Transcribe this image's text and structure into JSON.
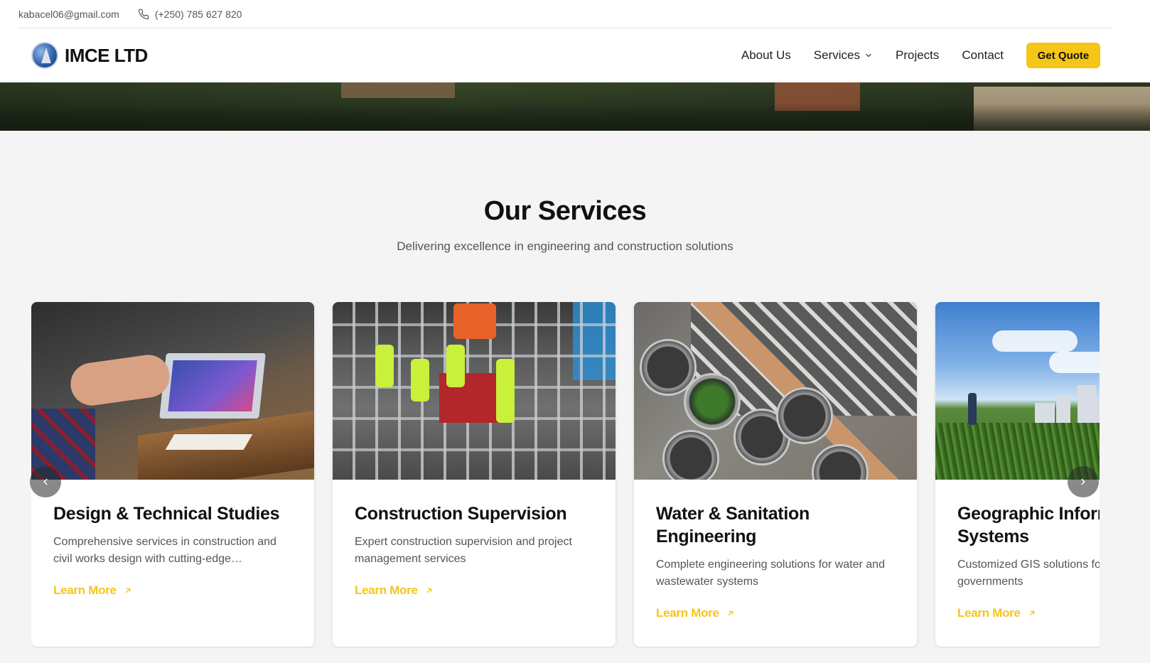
{
  "contact": {
    "email": "kabacel06@gmail.com",
    "phone": "(+250) 785 627 820"
  },
  "brand": {
    "name": "IMCE LTD"
  },
  "nav": {
    "items": [
      {
        "label": "About Us"
      },
      {
        "label": "Services"
      },
      {
        "label": "Projects"
      },
      {
        "label": "Contact"
      }
    ],
    "cta": "Get Quote"
  },
  "section": {
    "title": "Our Services",
    "subtitle": "Delivering excellence in engineering and construction solutions"
  },
  "cards": [
    {
      "title": "Design & Technical Studies",
      "description": "Comprehensive services in construction and civil works design with cutting-edge…",
      "link": "Learn More"
    },
    {
      "title": "Construction Supervision",
      "description": "Expert construction supervision and project management services",
      "link": "Learn More"
    },
    {
      "title": "Water & Sanitation Engineering",
      "description": "Complete engineering solutions for water and wastewater systems",
      "link": "Learn More"
    },
    {
      "title": "Geographic Information Systems",
      "description": "Customized GIS solutions for businesses and governments",
      "link": "Learn More"
    }
  ],
  "colors": {
    "accent": "#f5c518",
    "background": "#f4f4f4",
    "text": "#111111",
    "muted": "#555555"
  },
  "icons": [
    "phone-icon",
    "chevron-down-icon",
    "arrow-up-right-icon",
    "chevron-left-icon",
    "chevron-right-icon",
    "logo-icon"
  ]
}
